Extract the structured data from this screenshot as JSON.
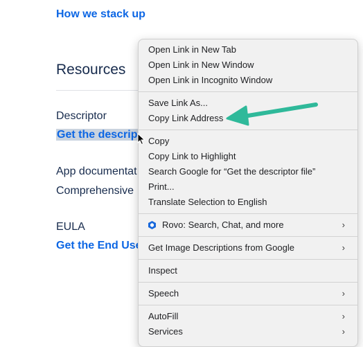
{
  "page": {
    "compare_link": "How we stack up",
    "resources_heading": "Resources",
    "descriptor_label": "Descriptor",
    "descriptor_link": "Get the descrip",
    "app_docs_label": "App documentat",
    "app_docs_text": "Comprehensive",
    "eula_label": "EULA",
    "eula_link": "Get the End Use"
  },
  "context_menu": {
    "group1": [
      "Open Link in New Tab",
      "Open Link in New Window",
      "Open Link in Incognito Window"
    ],
    "group2": [
      "Save Link As...",
      "Copy Link Address"
    ],
    "group3": [
      "Copy",
      "Copy Link to Highlight",
      "Search Google for “Get the descriptor file”",
      "Print...",
      "Translate Selection to English"
    ],
    "rovo": "Rovo: Search, Chat, and more",
    "image_desc": "Get Image Descriptions from Google",
    "inspect": "Inspect",
    "speech": "Speech",
    "autofill": "AutoFill",
    "services": "Services"
  },
  "icons": {
    "rovo": "rovo-icon",
    "submenu": "chevron-right-icon",
    "cursor": "mouse-pointer-icon",
    "annotation": "arrow-icon"
  },
  "colors": {
    "link": "#0c66e4",
    "annotation_arrow": "#2fb99a",
    "menu_bg": "#f1f1f1"
  }
}
